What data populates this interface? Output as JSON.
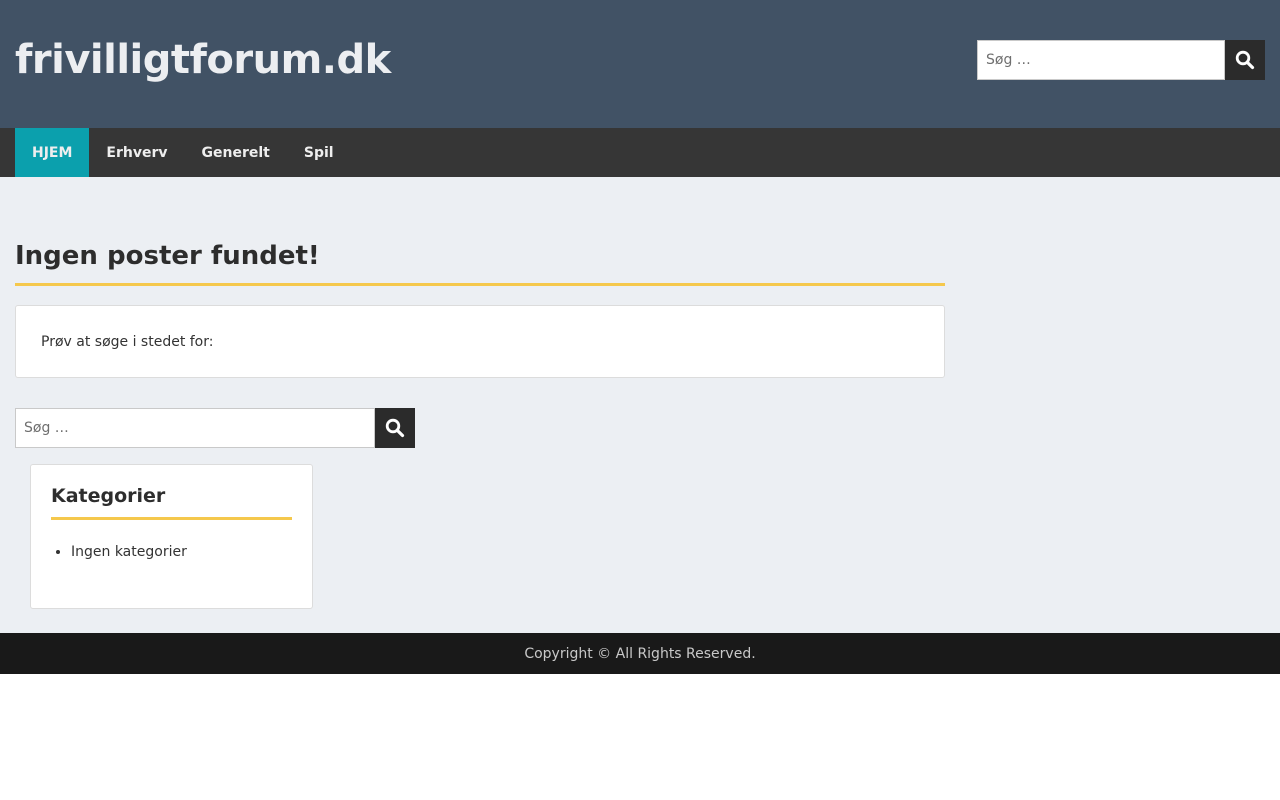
{
  "header": {
    "site_title": "frivilligtforum.dk",
    "search_placeholder": "Søg …",
    "search_icon": "search-icon"
  },
  "nav": {
    "items": [
      {
        "label": "HJEM",
        "active": true
      },
      {
        "label": "Erhverv",
        "active": false
      },
      {
        "label": "Generelt",
        "active": false
      },
      {
        "label": "Spil",
        "active": false
      }
    ]
  },
  "main": {
    "heading": "Ingen poster fundet!",
    "notice": "Prøv at søge i stedet for:",
    "search_placeholder": "Søg …"
  },
  "widget": {
    "title": "Kategorier",
    "items": [
      "Ingen kategorier"
    ]
  },
  "footer": {
    "copyright": "Copyright © All Rights Reserved."
  },
  "colors": {
    "header_bg": "#415265",
    "nav_bg": "#363636",
    "nav_active": "#0ba0ad",
    "accent_underline": "#f5c84c",
    "content_bg": "#eceff3",
    "footer_bg": "#191919"
  }
}
